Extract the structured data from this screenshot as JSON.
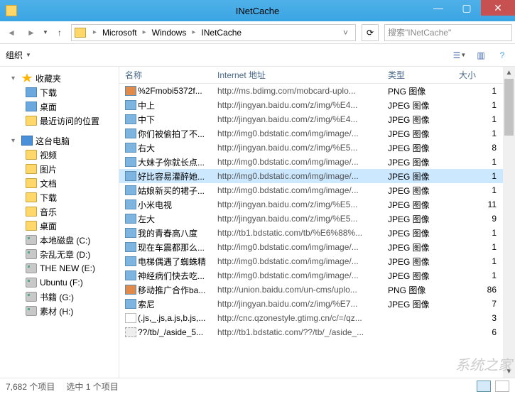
{
  "window": {
    "title": "INetCache"
  },
  "breadcrumb": {
    "items": [
      "Microsoft",
      "Windows",
      "INetCache"
    ]
  },
  "search": {
    "placeholder": "搜索\"INetCache\""
  },
  "cmdbar": {
    "organize": "组织"
  },
  "columns": {
    "name": "名称",
    "url": "Internet 地址",
    "type": "类型",
    "size": "大小"
  },
  "sidebar": {
    "favorites": "收藏夹",
    "fav_items": [
      "下载",
      "桌面",
      "最近访问的位置"
    ],
    "this_pc": "这台电脑",
    "pc_items": [
      "视频",
      "图片",
      "文档",
      "下载",
      "音乐",
      "桌面"
    ],
    "drives": [
      "本地磁盘 (C:)",
      "杂乱无章 (D:)",
      "THE NEW (E:)",
      "Ubuntu (F:)",
      "书籍 (G:)",
      "素材 (H:)"
    ]
  },
  "files": [
    {
      "icon": "png",
      "name": "%2Fmobi5372f...",
      "url": "http://ms.bdimg.com/mobcard-uplo...",
      "type": "PNG 图像",
      "size": "1"
    },
    {
      "icon": "jpg",
      "name": "中上",
      "url": "http://jingyan.baidu.com/z/img/%E4...",
      "type": "JPEG 图像",
      "size": "1"
    },
    {
      "icon": "jpg",
      "name": "中下",
      "url": "http://jingyan.baidu.com/z/img/%E4...",
      "type": "JPEG 图像",
      "size": "1"
    },
    {
      "icon": "jpg",
      "name": "你们被偷拍了不...",
      "url": "http://img0.bdstatic.com/img/image/...",
      "type": "JPEG 图像",
      "size": "1"
    },
    {
      "icon": "jpg",
      "name": "右大",
      "url": "http://jingyan.baidu.com/z/img/%E5...",
      "type": "JPEG 图像",
      "size": "8"
    },
    {
      "icon": "jpg",
      "name": "大妹子你就长点...",
      "url": "http://img0.bdstatic.com/img/image/...",
      "type": "JPEG 图像",
      "size": "1"
    },
    {
      "icon": "jpg",
      "name": "好比容易灌醉她...",
      "url": "http://img0.bdstatic.com/img/image/...",
      "type": "JPEG 图像",
      "size": "1",
      "selected": true
    },
    {
      "icon": "jpg",
      "name": "姑娘新买的裙子...",
      "url": "http://img0.bdstatic.com/img/image/...",
      "type": "JPEG 图像",
      "size": "1"
    },
    {
      "icon": "jpg",
      "name": "小米电视",
      "url": "http://jingyan.baidu.com/z/img/%E5...",
      "type": "JPEG 图像",
      "size": "11"
    },
    {
      "icon": "jpg",
      "name": "左大",
      "url": "http://jingyan.baidu.com/z/img/%E5...",
      "type": "JPEG 图像",
      "size": "9"
    },
    {
      "icon": "jpg",
      "name": "我的青春高八度",
      "url": "http://tb1.bdstatic.com/tb/%E6%88%...",
      "type": "JPEG 图像",
      "size": "1"
    },
    {
      "icon": "jpg",
      "name": "现在车震都那么...",
      "url": "http://img0.bdstatic.com/img/image/...",
      "type": "JPEG 图像",
      "size": "1"
    },
    {
      "icon": "jpg",
      "name": "电梯偶遇了蜘蛛精",
      "url": "http://img0.bdstatic.com/img/image/...",
      "type": "JPEG 图像",
      "size": "1"
    },
    {
      "icon": "jpg",
      "name": "神经病们快去吃...",
      "url": "http://img0.bdstatic.com/img/image/...",
      "type": "JPEG 图像",
      "size": "1"
    },
    {
      "icon": "png",
      "name": "移动推广合作ba...",
      "url": "http://union.baidu.com/un-cms/uplo...",
      "type": "PNG 图像",
      "size": "86"
    },
    {
      "icon": "jpg",
      "name": "索尼",
      "url": "http://jingyan.baidu.com/z/img/%E7...",
      "type": "JPEG 图像",
      "size": "7"
    },
    {
      "icon": "js",
      "name": "(.js,_.js,a.js,b.js,...",
      "url": "http://cnc.qzonestyle.gtimg.cn/c/=/qz...",
      "type": "",
      "size": "3"
    },
    {
      "icon": "other",
      "name": "??/tb/_/aside_5...",
      "url": "http://tb1.bdstatic.com/??/tb/_/aside_...",
      "type": "",
      "size": "6"
    }
  ],
  "status": {
    "count": "7,682 个项目",
    "selected": "选中 1 个项目"
  },
  "watermark": "系统之家"
}
